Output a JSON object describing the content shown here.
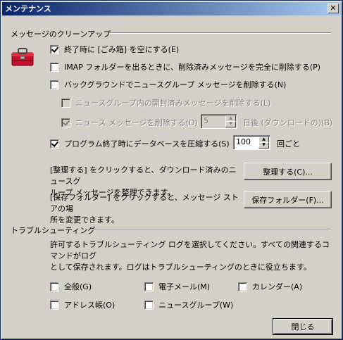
{
  "window": {
    "title": "メンテナンス",
    "close_glyph": "✕"
  },
  "cleanup": {
    "heading": "メッセージのクリーンアップ",
    "empty_trash": {
      "label": "終了時に [ごみ箱] を空にする(E)",
      "checked": true
    },
    "imap_purge": {
      "label": "IMAP フォルダーを出るときに、削除済みメッセージを完全に削除する(P)",
      "checked": false
    },
    "background_news": {
      "label": "バックグラウンドでニュースグループ メッセージを削除する(N)",
      "checked": false
    },
    "news_read": {
      "label": "ニュースグループ内の開封済みメッセージを削除する(L)",
      "checked": false
    },
    "news_delete": {
      "label": "ニュース メッセージを削除する(D)",
      "checked": true
    },
    "days_value": "5",
    "days_suffix": "日後 (ダウンロードの)(B)",
    "compact_db": {
      "label": "プログラム終了時にデータベースを圧縮する(S)",
      "checked": true
    },
    "compact_value": "100",
    "compact_suffix": "回ごと",
    "tidy_desc_1": "[整理する] をクリックすると、ダウンロード済みのニュースグ",
    "tidy_desc_2": "ループ メッセージを整理できます。",
    "tidy_button": "整理する(C)...",
    "store_desc_1": "[保存フォルダー] をクリックすると、メッセージ ストアの場",
    "store_desc_2": "所を変更できます。",
    "store_button": "保存フォルダー(F)..."
  },
  "troubleshooting": {
    "heading": "トラブルシューティング",
    "desc_1": "許可するトラブルシューティング ログを選択してください。すべての関連するコマンドがログ",
    "desc_2": "として保存されます。ログはトラブルシューティングのときに役立ちます。",
    "general": {
      "label": "全般(G)",
      "checked": false
    },
    "email": {
      "label": "電子メール(M)",
      "checked": false
    },
    "calendar": {
      "label": "カレンダー(A)",
      "checked": false
    },
    "addressbook": {
      "label": "アドレス帳(O)",
      "checked": false
    },
    "newsgroup": {
      "label": "ニュースグループ(W)",
      "checked": false
    }
  },
  "close_button": "閉じる",
  "icon": {
    "name": "toolbox-icon",
    "color": "#c8102e"
  }
}
